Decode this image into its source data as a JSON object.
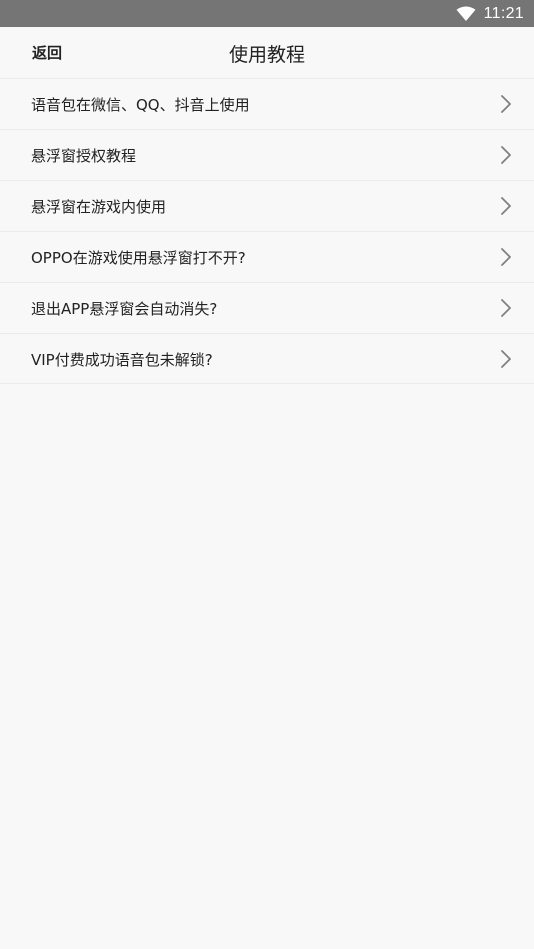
{
  "status_bar": {
    "time": "11:21",
    "wifi_icon": "wifi-icon"
  },
  "header": {
    "back_label": "返回",
    "title": "使用教程"
  },
  "tutorials": [
    {
      "label": "语音包在微信、QQ、抖音上使用",
      "icon": "chevron-right-icon"
    },
    {
      "label": "悬浮窗授权教程",
      "icon": "chevron-right-icon"
    },
    {
      "label": "悬浮窗在游戏内使用",
      "icon": "chevron-right-icon"
    },
    {
      "label": "OPPO在游戏使用悬浮窗打不开?",
      "icon": "chevron-right-icon"
    },
    {
      "label": "退出APP悬浮窗会自动消失?",
      "icon": "chevron-right-icon"
    },
    {
      "label": "VIP付费成功语音包未解锁?",
      "icon": "chevron-right-icon"
    }
  ],
  "colors": {
    "status_bar_bg": "#757575",
    "page_bg": "#f8f8f8",
    "divider": "#ebebeb",
    "text": "#222222",
    "chevron": "#808080"
  }
}
